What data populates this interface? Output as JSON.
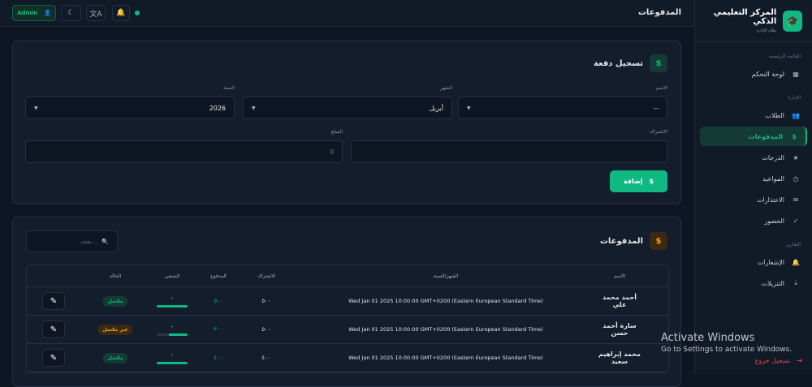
{
  "sidebar": {
    "title": "المركز التعليمي الذكي",
    "subtitle": "نظام الإدارة",
    "sections": {
      "main": "القائمة الرئيسية",
      "admin": "الإدارة",
      "reports": "التقارير"
    },
    "items": [
      {
        "label": "لوحة التحكم",
        "icon": "dashboard-icon"
      },
      {
        "label": "الطلاب",
        "icon": "users-icon"
      },
      {
        "label": "المدفوعات",
        "icon": "dollar-icon"
      },
      {
        "label": "الدرجات",
        "icon": "star-icon"
      },
      {
        "label": "المواعيد",
        "icon": "clock-icon"
      },
      {
        "label": "الاعتذارات",
        "icon": "mail-icon"
      },
      {
        "label": "الحضور",
        "icon": "check-icon"
      },
      {
        "label": "الإشعارات",
        "icon": "bell-icon"
      },
      {
        "label": "التنزيلات",
        "icon": "download-icon"
      }
    ],
    "logout": "تسجيل خروج"
  },
  "topbar": {
    "title": "المدفوعات",
    "user": "Admin"
  },
  "form": {
    "title": "تسجيل دفعة",
    "name_label": "الاسم",
    "name_value": "--",
    "month_label": "الشهر",
    "month_value": "أبريل",
    "year_label": "السنة",
    "year_value": "2026",
    "sub_label": "الاشتراك",
    "sub_value": "",
    "amount_label": "المبلغ",
    "amount_placeholder": "0",
    "add": "إضافة"
  },
  "list": {
    "title": "المدفوعات",
    "search_placeholder": "بحث...",
    "columns": [
      "الاسم",
      "الشهر/السنة",
      "الاشتراك",
      "المدفوع",
      "المتبقي",
      "الحالة"
    ],
    "rows": [
      {
        "name": "أحمد محمد علي",
        "date": "Wed Jan 01 2025 10:00:00 GMT+0200 (Eastern European Standard Time)",
        "sub": "٥٠٠",
        "paid": "٥٠٠",
        "rem": "-",
        "progress": 100,
        "status": "مكتمل",
        "ok": true
      },
      {
        "name": "سارة أحمد حسن",
        "date": "Wed Jan 01 2025 10:00:00 GMT+0200 (Eastern European Standard Time)",
        "sub": "٥٠٠",
        "paid": "٣٠٠",
        "rem": "-",
        "progress": 60,
        "status": "غير مكتمل",
        "ok": false
      },
      {
        "name": "محمد إبراهيم سعيد",
        "date": "Wed Jan 01 2025 10:00:00 GMT+0200 (Eastern European Standard Time)",
        "sub": "٤٠٠",
        "paid": "٤٠٠",
        "rem": "-",
        "progress": 100,
        "status": "مكتمل",
        "ok": true
      }
    ]
  },
  "watermark": {
    "line1": "Activate Windows",
    "line2": "Go to Settings to activate Windows."
  }
}
